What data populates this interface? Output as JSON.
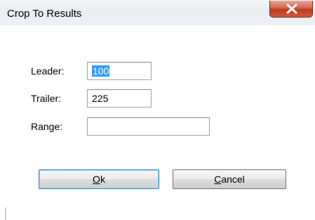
{
  "window": {
    "title": "Crop To Results"
  },
  "form": {
    "leader": {
      "label": "Leader:",
      "value": "100"
    },
    "trailer": {
      "label": "Trailer:",
      "value": "225"
    },
    "range": {
      "label": "Range:",
      "value": ""
    }
  },
  "buttons": {
    "ok": {
      "accel": "O",
      "rest": "k"
    },
    "cancel": {
      "accel": "C",
      "rest": "ancel"
    }
  },
  "icons": {
    "close": "close-x-icon"
  }
}
